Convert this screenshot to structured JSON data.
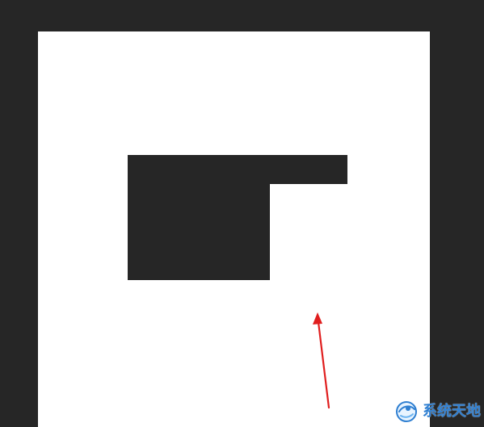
{
  "workspace": {
    "background_color": "#262626"
  },
  "canvas": {
    "background_color": "#ffffff",
    "shape_fill_color": "#262626",
    "arrow_color": "#e01e1e"
  },
  "watermark": {
    "text": "系统天地",
    "logo_icon": "globe-swirl-logo"
  }
}
